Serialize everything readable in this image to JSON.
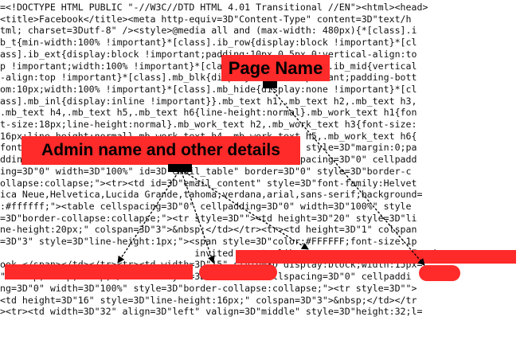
{
  "source_lines": [
    "=<!DOCTYPE HTML PUBLIC \"-//W3C//DTD HTML 4.01 Transitional //EN\"><html><head>",
    "<title>Facebook</title><meta http-equiv=3D\"Content-Type\" content=3D\"text/h",
    "tml; charset=3Dutf-8\" /><style>@media all and (max-width: 480px){*[class].i",
    "b_t{min-width:100% !important}*[class].ib_row{display:block !important}*[cl",
    "ass].ib_ext{display:block !important;padding:10px 0 5px 0;vertical-align:to",
    "p !important;width:100% !important}*[class].ib_img,*[class].ib_mid{vertical",
    "-align:top !important}*[class].mb_blk{display:block !important;padding-bott",
    "om:10px;width:100% !important}*[class].mb_hide{display:none !important}*[cl",
    "ass].mb_inl{display:inline !important}}.mb_text h1,.mb_text h2,.mb_text h3,",
    ".mb_text h4,.mb_text h5,.mb_text h6{line-height:normal}.mb_work_text h1{fon",
    "t-size:18px;line-height:normal}.mb_work_text h2,.mb_work_text h3{font-size:",
    "16px;line-height:normal}.mb_work_text h4,.mb_work_text h5,.mb_work_text h6{",
    "font-size:14px;line-height:normal}</style></head><body style=3D\"margin:0;pa",
    "dding:0;\" dir=3D\"ltr\" bgcolor=3D\"#ffffff\"><table cellspacing=3D\"0\" cellpadd",
    "ing=3D\"0\" width=3D\"100%\" id=3D\"email_table\" border=3D\"0\" style=3D\"border-c",
    "ollapse:collapse;\"><tr><td id=3D\"email_content\" style=3D\"font-family:Helvet",
    "ica Neue,Helvetica,Lucida Grande,tahoma,verdana,arial,sans-serif;background=",
    ":#ffffff;\"><table cellspacing=3D\"0\" cellpadding=3D\"0\" width=3D\"100%\" style",
    "=3D\"border-collapse:collapse;\"><tr style=3D\"\"><td height=3D\"20\" style=3D\"li",
    "ne-height:20px;\" colspan=3D\"3\">&nbsp;</td></tr><tr><td height=3D\"1\" colspan",
    "=3D\"3\" style=3D\"line-height:1px;\"><span style=3D\"color:#FFFFFF;font-size:1p",
    "                                   invited you to like                 on Faceb",
    "ook.</span></td></tr><tr><td width=3D\"15\" style=3D\"display:block;width:15px=",
    "\">&nbsp;&nbsp;&nbsp;</td><td style=3D\"\"><table cellspacing=3D\"0\" cellpaddi",
    "ng=3D\"0\" width=3D\"100%\" style=3D\"border-collapse:collapse;\"><tr style=3D\"\">",
    "<td height=3D\"16\" style=3D\"line-height:16px;\" colspan=3D\"3\">&nbsp;</td></tr",
    "><tr><td width=3D\"32\" align=3D\"left\" valign=3D\"middle\" style=3D\"height:32;l="
  ],
  "annotations": {
    "page_name": "Page Name",
    "admin_details": "Admin name and other details"
  },
  "colors": {
    "highlight": "#ff2a2a",
    "code_text": "#111111",
    "arrow": "#000000"
  }
}
